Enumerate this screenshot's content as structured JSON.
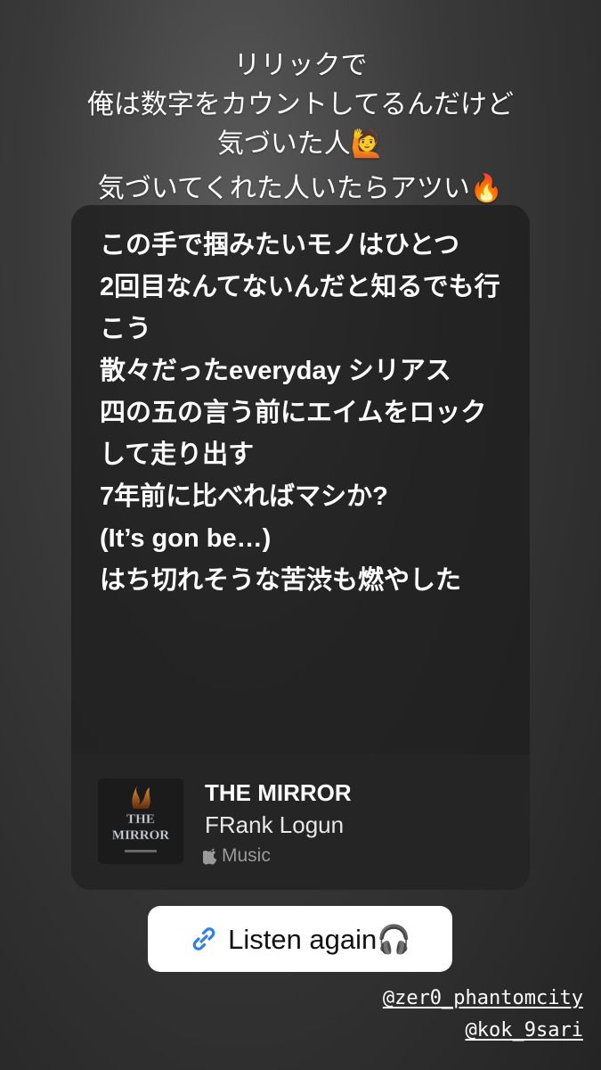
{
  "caption": {
    "line1": "リリックで",
    "line2": "俺は数字をカウントしてるんだけど",
    "line3": "気づいた人🙋",
    "line4": "気づいてくれた人いたらアツい🔥"
  },
  "lyrics": [
    "この手で掴みたいモノはひとつ",
    "2回目なんてないんだと知るでも行こう",
    "散々だったeveryday シリアス",
    "四の五の言う前にエイムをロックして走り出す",
    "7年前に比べればマシか?",
    "(It’s gon be…)",
    "はち切れそうな苦渋も燃やした"
  ],
  "track": {
    "title": "THE MIRROR",
    "artist": "FRank Logun",
    "service": "Music",
    "album_art_text": "THE MIRROR"
  },
  "sticker": {
    "label": "Listen again🎧"
  },
  "mentions": [
    "@zer0_phantomcity",
    "@kok_9sari"
  ],
  "icons": {
    "link": "link-icon",
    "apple": "apple-logo-icon"
  },
  "colors": {
    "link_blue": "#2f80ed",
    "card_bg": "#1e1e1e"
  }
}
